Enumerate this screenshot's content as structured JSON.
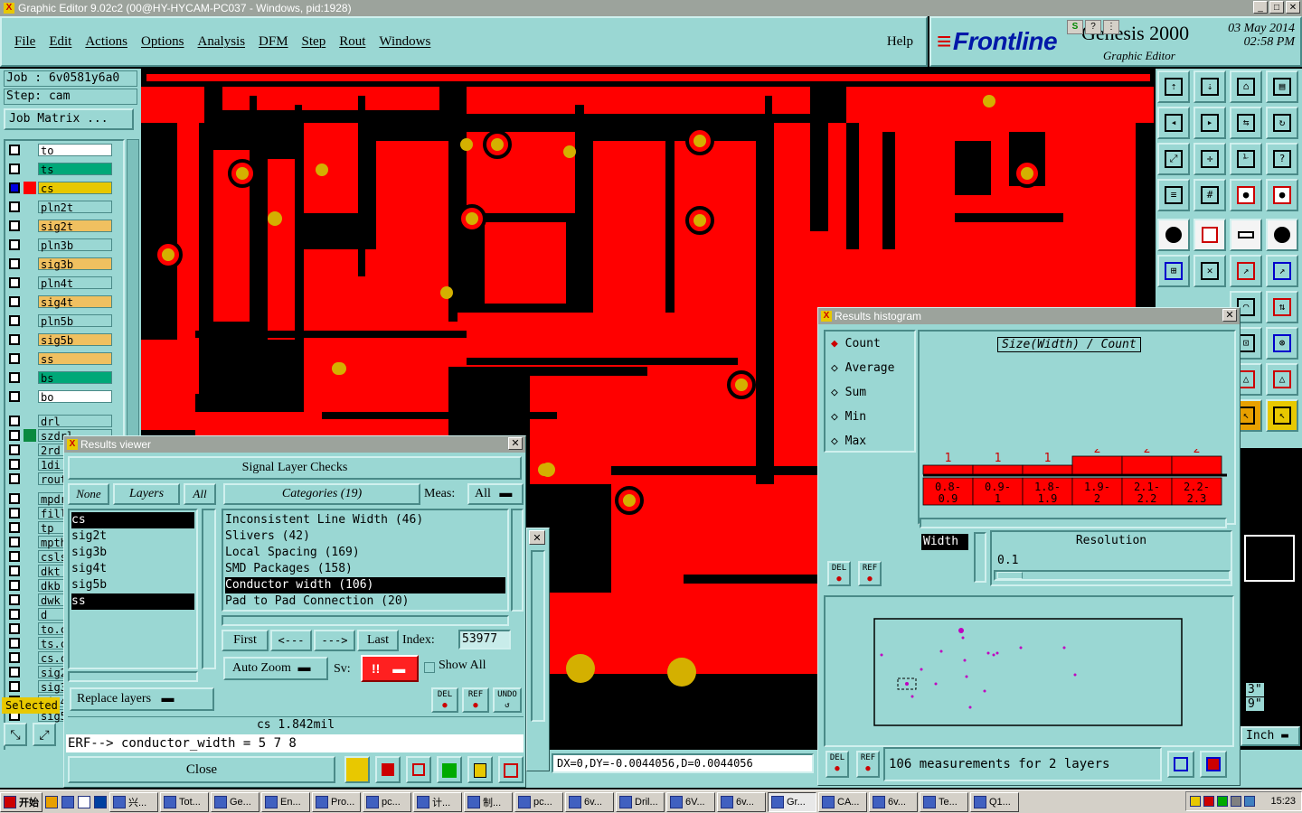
{
  "window": {
    "title": "Graphic Editor 9.02c2 (00@HY-HYCAM-PC037 - Windows, pid:1928)",
    "controls": [
      "_",
      "□",
      "✕"
    ]
  },
  "menubar": {
    "items": [
      "File",
      "Edit",
      "Actions",
      "Options",
      "Analysis",
      "DFM",
      "Step",
      "Rout",
      "Windows"
    ],
    "help": "Help"
  },
  "brand": {
    "logo": "Frontline",
    "product": "Genesis 2000",
    "subtitle": "Graphic Editor",
    "date": "03 May 2014",
    "time": "02:58 PM"
  },
  "job": {
    "job_line": "Job : 6v0581y6a0",
    "step_line": "Step: cam",
    "matrix_button": "Job Matrix ..."
  },
  "layers": [
    {
      "name": "to",
      "color": "#ffffff"
    },
    {
      "name": "ts",
      "color": "#00a878"
    },
    {
      "name": "cs",
      "color": "#e8c800",
      "active": true
    },
    {
      "name": "pln2t",
      "color": "#9ad7d3"
    },
    {
      "name": "sig2t",
      "color": "#f0c060"
    },
    {
      "name": "pln3b",
      "color": "#9ad7d3"
    },
    {
      "name": "sig3b",
      "color": "#f0c060"
    },
    {
      "name": "pln4t",
      "color": "#9ad7d3"
    },
    {
      "name": "sig4t",
      "color": "#f0c060"
    },
    {
      "name": "pln5b",
      "color": "#9ad7d3"
    },
    {
      "name": "sig5b",
      "color": "#f0c060"
    },
    {
      "name": "ss",
      "color": "#f0c060"
    },
    {
      "name": "bs",
      "color": "#00a878"
    },
    {
      "name": "bo",
      "color": "#ffffff"
    },
    {
      "name": "drl",
      "color": "#9ad7d3"
    },
    {
      "name": "szdrl",
      "color": "#9ad7d3"
    },
    {
      "name": "2rd",
      "color": "#9ad7d3"
    },
    {
      "name": "1di",
      "color": "#9ad7d3"
    },
    {
      "name": "rout",
      "color": "#9ad7d3"
    },
    {
      "name": "mpdr",
      "color": "#9ad7d3"
    },
    {
      "name": "fill",
      "color": "#9ad7d3"
    },
    {
      "name": "tp",
      "color": "#9ad7d3"
    },
    {
      "name": "mpth",
      "color": "#9ad7d3"
    },
    {
      "name": "csls",
      "color": "#9ad7d3"
    },
    {
      "name": "dkt",
      "color": "#9ad7d3"
    },
    {
      "name": "dkb",
      "color": "#9ad7d3"
    },
    {
      "name": "dwk",
      "color": "#9ad7d3"
    },
    {
      "name": "d",
      "color": "#9ad7d3"
    },
    {
      "name": "to.c",
      "color": "#9ad7d3"
    },
    {
      "name": "ts.c",
      "color": "#9ad7d3"
    },
    {
      "name": "cs.c",
      "color": "#9ad7d3"
    },
    {
      "name": "sig2",
      "color": "#9ad7d3"
    },
    {
      "name": "sig3",
      "color": "#9ad7d3"
    },
    {
      "name": "sig4",
      "color": "#9ad7d3"
    },
    {
      "name": "sig5",
      "color": "#9ad7d3"
    }
  ],
  "selected_label": "Selected",
  "results_viewer": {
    "title": "Results viewer",
    "header": "Signal Layer Checks",
    "layer_buttons": {
      "none": "None",
      "layers": "Layers",
      "all": "All"
    },
    "layers": [
      "cs",
      "sig2t",
      "sig3b",
      "sig4t",
      "sig5b",
      "ss"
    ],
    "categories_button": "Categories (19)",
    "meas_label": "Meas:",
    "meas_value": "All",
    "categories": [
      "Inconsistent Line Width (46)",
      "Slivers (42)",
      "Local Spacing (169)",
      "SMD Packages (158)",
      "Conductor width (106)",
      "Pad to Pad Connection (20)"
    ],
    "nav": {
      "first": "First",
      "prev": "<---",
      "next": "--->",
      "last": "Last"
    },
    "index_label": "Index:",
    "index_value": "53977",
    "auto_zoom": "Auto Zoom",
    "sv_label": "Sv:",
    "sv_value": "!!",
    "show_all": "Show All",
    "replace_layers": "Replace layers",
    "small_buttons": [
      "DEL",
      "REF",
      "UNDO"
    ],
    "measurement": "cs 1.842mil",
    "erf_line": "ERF--> conductor_width = 5 7 8",
    "close": "Close"
  },
  "histogram": {
    "title": "Results histogram",
    "modes": [
      "Count",
      "Average",
      "Sum",
      "Min",
      "Max"
    ],
    "selected_mode": "Count",
    "chart_title": "Size(Width) / Count",
    "resolution_label": "Resolution",
    "resolution_value": "0.1",
    "width_label": "Width",
    "measurements": "106 measurements for 2 layers",
    "buttons": [
      "DEL",
      "REF"
    ]
  },
  "chart_data": {
    "type": "bar",
    "title": "Size(Width) / Count",
    "categories": [
      "0.8-0.9",
      "0.9-1",
      "1.8-1.9",
      "1.9-2",
      "2.1-2.2",
      "2.2-2.3"
    ],
    "bin_labels": [
      [
        "0.8-",
        "0.9"
      ],
      [
        "0.9-",
        "1"
      ],
      [
        "1.8-",
        "1.9"
      ],
      [
        "1.9-",
        "2"
      ],
      [
        "2.1-",
        "2.2"
      ],
      [
        "2.2-",
        "2.3"
      ]
    ],
    "values": [
      1,
      1,
      1,
      2,
      2,
      2
    ],
    "ylim": [
      0,
      2
    ]
  },
  "status": {
    "coords": "DX=0,DY=-0.0044056,D=0.0044056",
    "units": "Inch",
    "right_vals": [
      "3\"",
      "9\""
    ]
  },
  "taskbar": {
    "start": "开始",
    "items": [
      "兴...",
      "Tot...",
      "Ge...",
      "En...",
      "Pro...",
      "pc...",
      "计...",
      "制...",
      "pc...",
      "6v...",
      "Dril...",
      "6V...",
      "6v...",
      "Gr...",
      "CA...",
      "6v...",
      "Te...",
      "Q1..."
    ],
    "clock": "15:23"
  }
}
